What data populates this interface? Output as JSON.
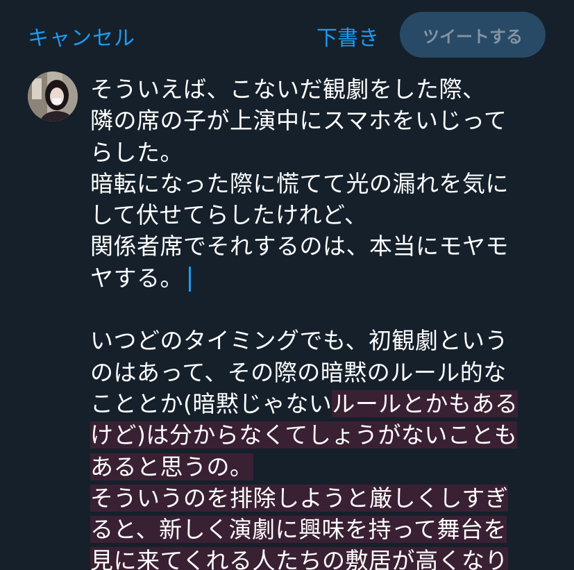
{
  "header": {
    "cancel_label": "キャンセル",
    "draft_label": "下書き",
    "tweet_label": "ツイートする"
  },
  "compose": {
    "lines": [
      "そういえば、こないだ観劇をした際、",
      "隣の席の子が上演中にスマホをいじって",
      "らした。",
      "暗転になった際に慌てて光の漏れを気に",
      "して伏せてらしたけれど、",
      "関係者席でそれするのは、本当にモヤモ",
      "ヤする。",
      "",
      "いつどのタイミングでも、初観劇という",
      "のはあって、その際の暗黙のルール的な",
      "こととか(暗黙じゃない",
      "ルールとかもある",
      "けど)は分からなくてしょうがないことも",
      "あると思うの。",
      "そういうのを排除しようと厳しくしすぎ",
      "ると、新しく演劇に興味を持って舞台を",
      "見に来てくれる人たちの敷居が高くなり"
    ]
  },
  "colors": {
    "background": "#15202b",
    "accent": "#1d9bf0",
    "tweet_button_bg": "#294a66",
    "tweet_button_text": "#8493a2",
    "overlay": "#3a2033"
  }
}
